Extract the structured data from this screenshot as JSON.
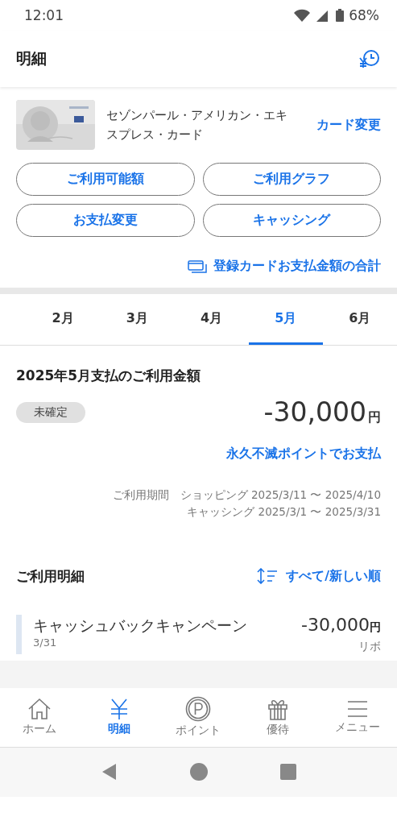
{
  "status_bar": {
    "time": "12:01",
    "battery": "68%"
  },
  "header": {
    "title": "明細"
  },
  "card": {
    "name": "セゾンパール・アメリカン・エキスプレス・カード",
    "change": "カード変更"
  },
  "actions": [
    "ご利用可能額",
    "ご利用グラフ",
    "お支払変更",
    "キャッシング"
  ],
  "total_link": "登録カードお支払金額の合計",
  "tabs": [
    {
      "label": "2月",
      "selected": false
    },
    {
      "label": "3月",
      "selected": false
    },
    {
      "label": "4月",
      "selected": false
    },
    {
      "label": "5月",
      "selected": true
    },
    {
      "label": "6月",
      "selected": false
    }
  ],
  "summary": {
    "title": "2025年5月支払のご利用金額",
    "status": "未確定",
    "amount": "-30,000",
    "unit": "円",
    "points_link": "永久不滅ポイントでお支払",
    "period_label": "ご利用期間",
    "periods": [
      "ショッピング 2025/3/11 〜 2025/4/10",
      "キャッシング 2025/3/1 〜 2025/3/31"
    ]
  },
  "details": {
    "title": "ご利用明細",
    "sort": "すべて/新しい順",
    "items": [
      {
        "name": "キャッシュバックキャンペーン",
        "date": "3/31",
        "amount": "-30,000",
        "unit": "円",
        "method": "リボ"
      }
    ]
  },
  "bottom_nav": [
    {
      "label": "ホーム",
      "kind": "home",
      "selected": false
    },
    {
      "label": "明細",
      "kind": "yen",
      "selected": true
    },
    {
      "label": "ポイント",
      "kind": "point",
      "selected": false
    },
    {
      "label": "優待",
      "kind": "gift",
      "selected": false
    },
    {
      "label": "メニュー",
      "kind": "menu",
      "selected": false
    }
  ]
}
